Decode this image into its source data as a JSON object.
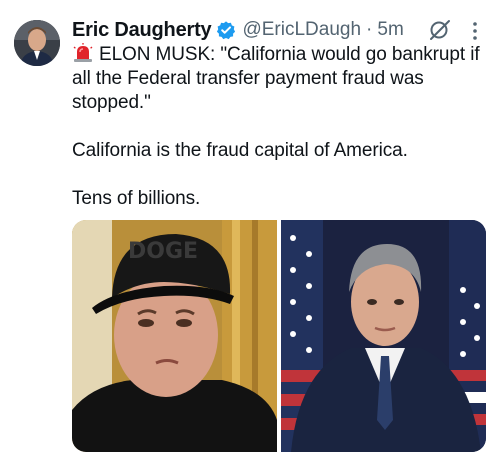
{
  "tweet": {
    "author_name": "Eric Daugherty",
    "handle": "@EricLDaugh",
    "separator": "·",
    "time": "5m",
    "lines": [
      "ELON MUSK: \"California would go bankrupt if all the Federal transfer payment fraud was stopped.\"",
      "California is the fraud capital of America.",
      "Tens of billions."
    ],
    "hat_text": "DOGE"
  },
  "icons": {
    "verified": "verified-badge-icon",
    "siren": "police-light-icon",
    "grok": "grok-icon",
    "more": "more-vertical-icon"
  },
  "colors": {
    "verified": "#1d9bf0",
    "secondary_text": "#536471",
    "text": "#0f1419",
    "siren": "#e0242b"
  }
}
